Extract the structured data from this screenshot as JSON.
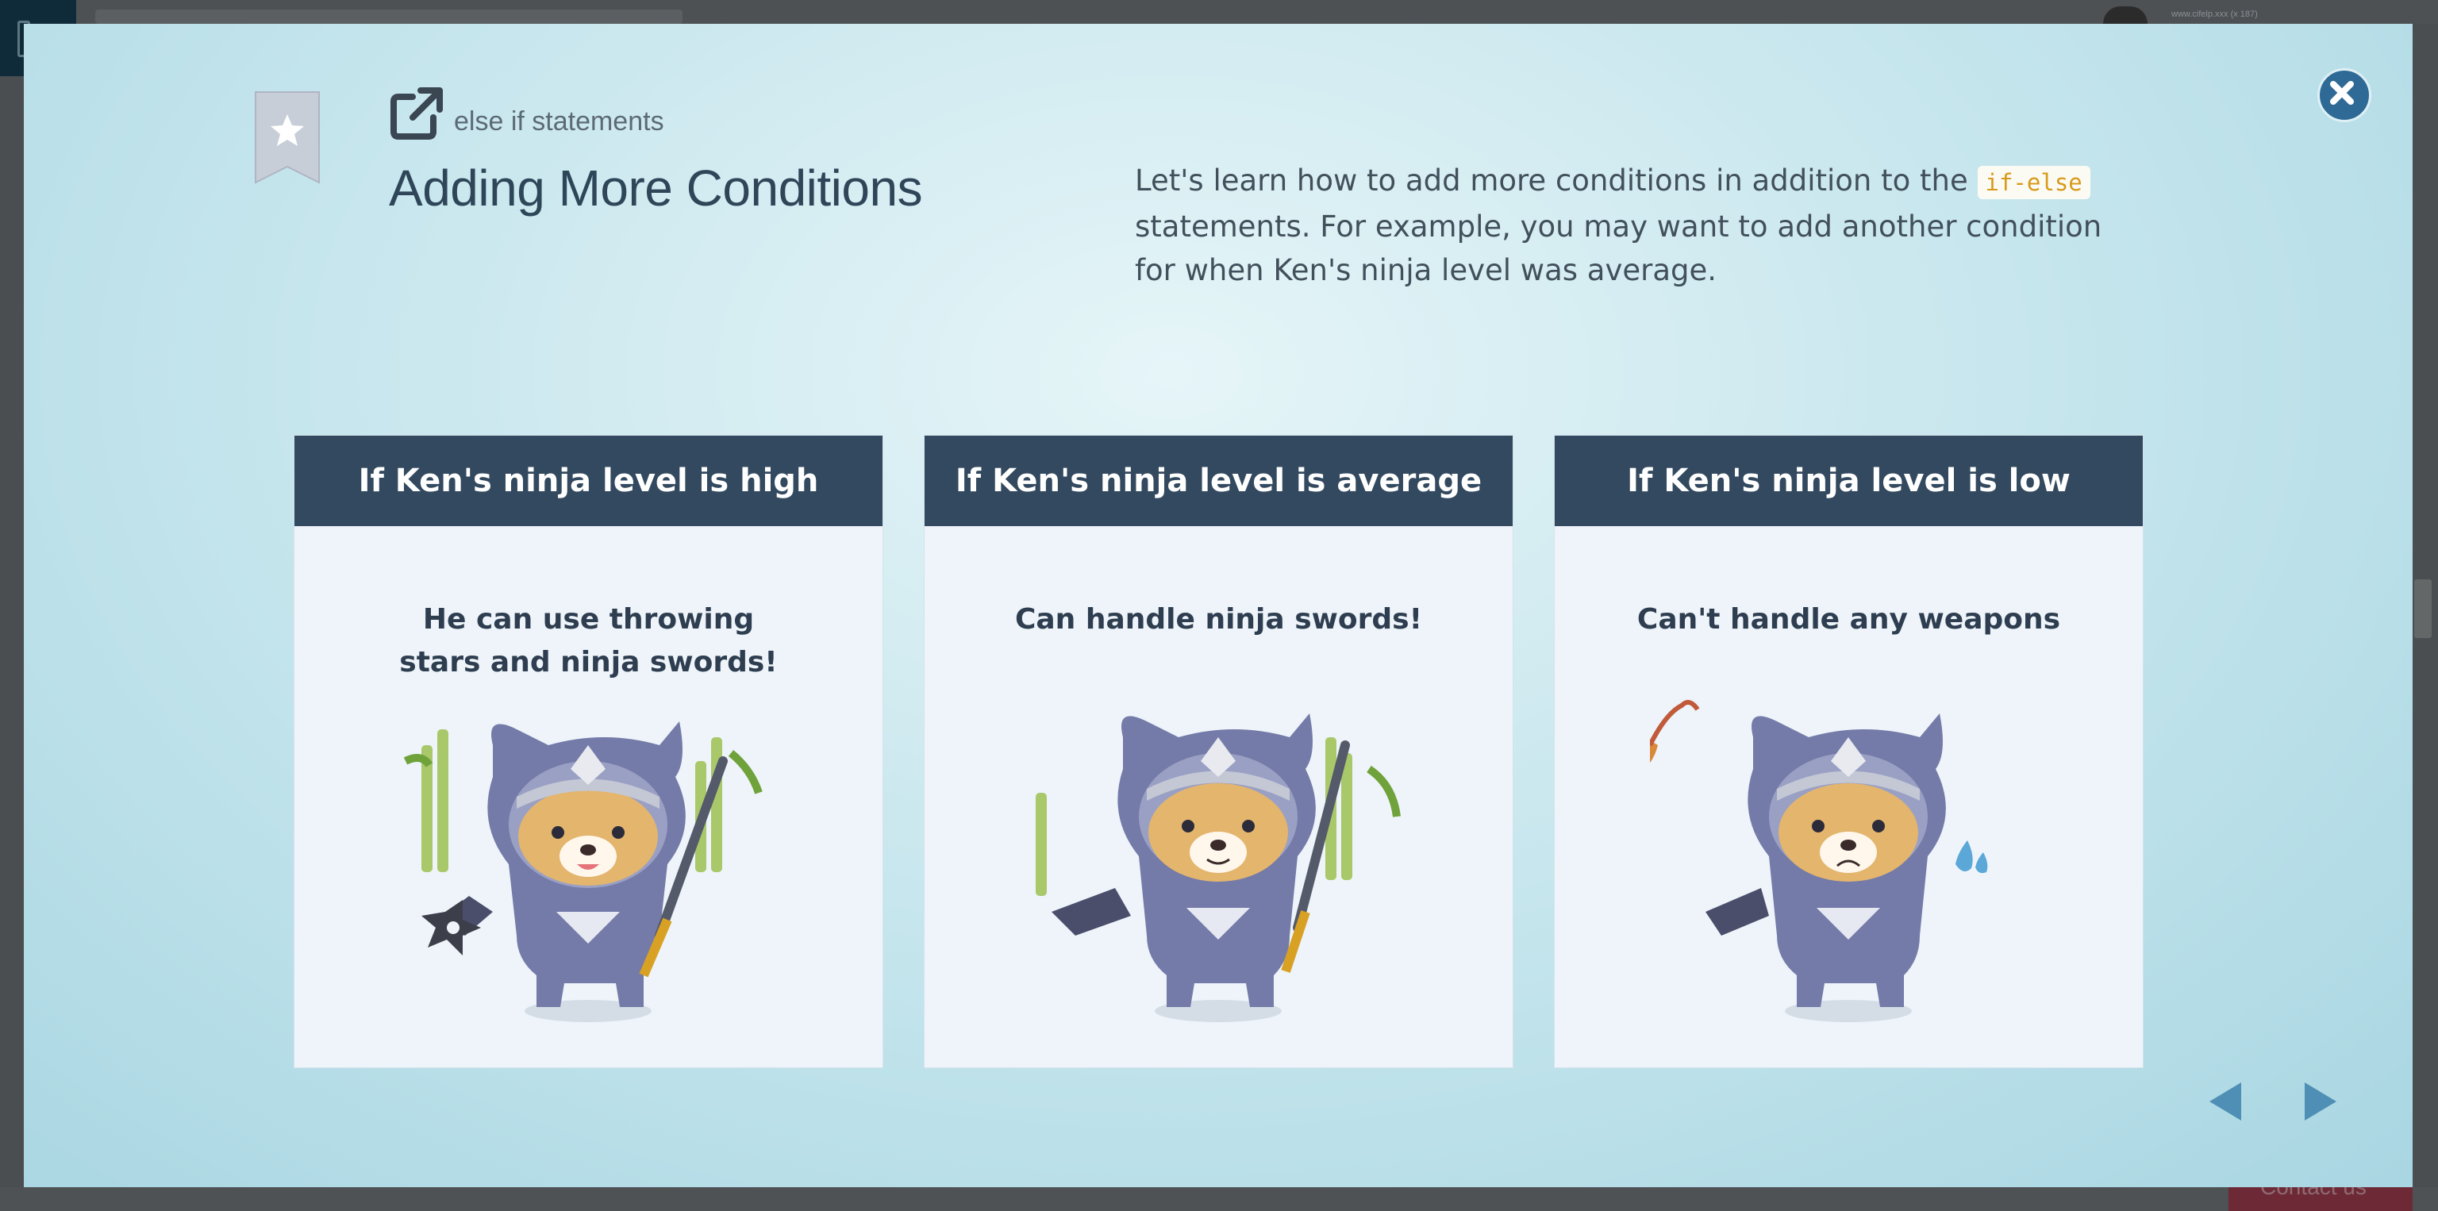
{
  "background": {
    "url_text": "www.cifelp.xxx (x 187)",
    "contact_label": "Contact us"
  },
  "lesson": {
    "chapter": "else if statements",
    "title": "Adding More Conditions",
    "desc_before": "Let's learn how to add more conditions in addition to the ",
    "desc_code": "if-else",
    "desc_after": " statements. For example, you may want to add another condition for when Ken's ninja level was average."
  },
  "cards": [
    {
      "header": "If Ken's ninja level is high",
      "text": "He can use throwing stars and ninja swords!"
    },
    {
      "header": "If Ken's ninja level is average",
      "text": "Can handle ninja swords!"
    },
    {
      "header": "If Ken's ninja level is low",
      "text": "Can't handle any weapons"
    }
  ],
  "colors": {
    "card_header": "#33495f",
    "close_button": "#2e6a95",
    "nav_arrow": "#4f8fb5",
    "code_text": "#d89a1a"
  },
  "icons": {
    "close": "close-icon",
    "bookmark": "star-bookmark-icon",
    "external": "external-link-icon",
    "prev": "prev-arrow-icon",
    "next": "next-arrow-icon"
  }
}
